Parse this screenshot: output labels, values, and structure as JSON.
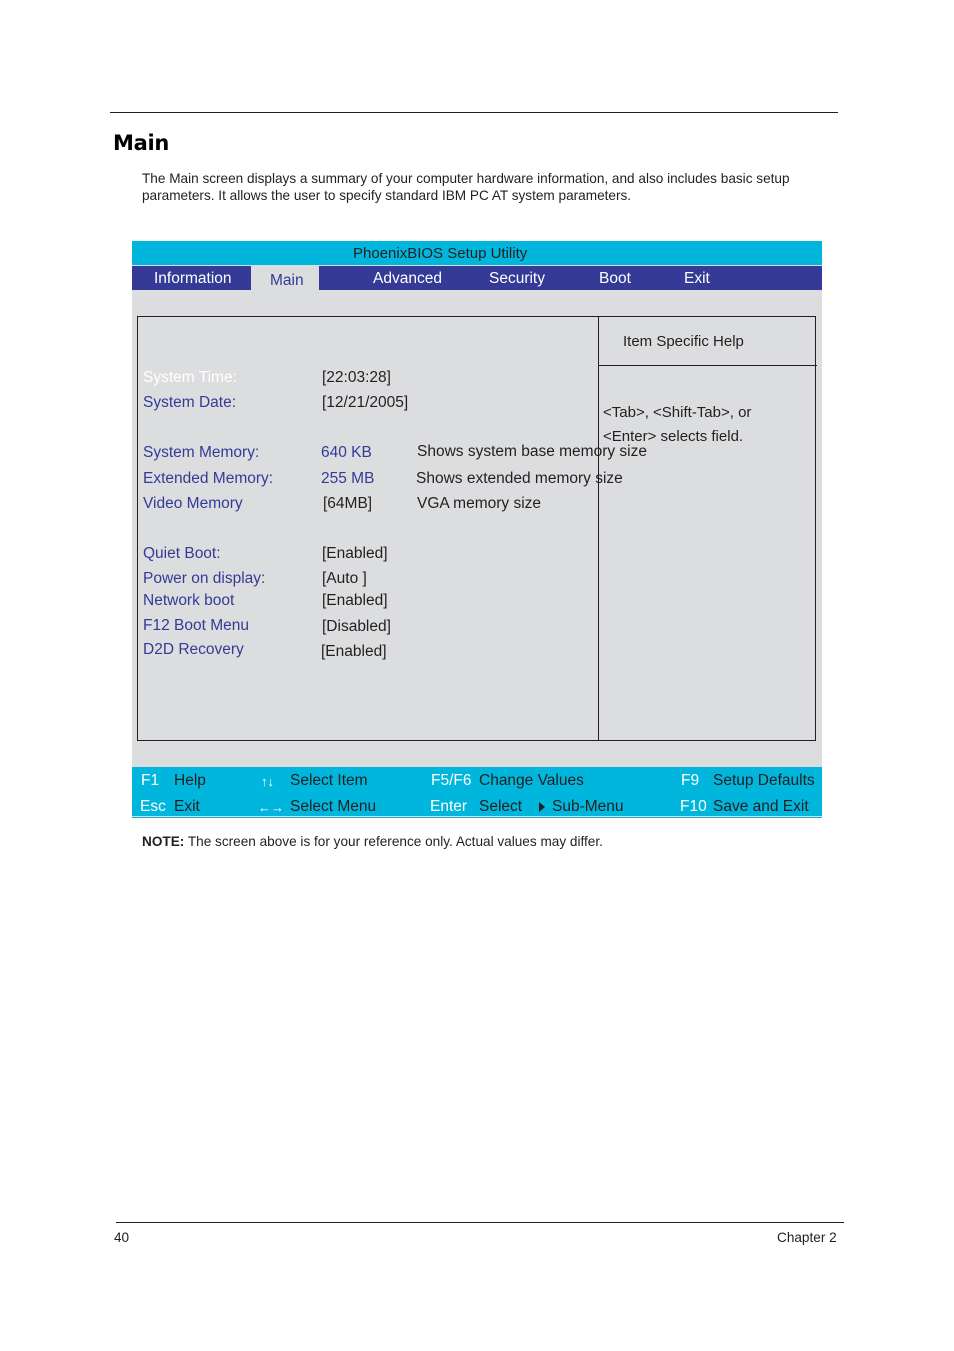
{
  "page": {
    "heading": "Main",
    "intro": "The Main screen displays a summary of your computer hardware information, and also includes basic setup parameters. It allows the user to specify standard IBM PC AT system parameters.",
    "note_label": "NOTE:",
    "note_text": " The screen above is for your reference only. Actual values may differ.",
    "footer_page": "40",
    "footer_chapter": "Chapter 2"
  },
  "bios": {
    "title": "PhoenixBIOS Setup Utility",
    "tabs": [
      {
        "label": "Information",
        "active": false
      },
      {
        "label": "Main",
        "active": true
      },
      {
        "label": "Advanced",
        "active": false
      },
      {
        "label": "Security",
        "active": false
      },
      {
        "label": "Boot",
        "active": false
      },
      {
        "label": "Exit",
        "active": false
      }
    ],
    "items": [
      {
        "label": "System Time:",
        "value": "[22:03:28]",
        "selected": true
      },
      {
        "label": "System Date:",
        "value": "[12/21/2005]"
      },
      {
        "label": "System Memory:",
        "value": "640 KB",
        "description": "Shows system base memory size"
      },
      {
        "label": "Extended Memory:",
        "value": "255 MB",
        "description": "Shows extended memory size"
      },
      {
        "label": "Video Memory",
        "value": "[64MB]",
        "description": "VGA memory size"
      },
      {
        "label": "Quiet Boot:",
        "value": "[Enabled]"
      },
      {
        "label": "Power on display:",
        "value": "[Auto ]"
      },
      {
        "label": "Network boot",
        "value": "[Enabled]"
      },
      {
        "label": "F12 Boot Menu",
        "value": "[Disabled]"
      },
      {
        "label": "D2D Recovery",
        "value": "[Enabled]"
      }
    ],
    "help": {
      "title": "Item Specific Help",
      "line1": "<Tab>, <Shift-Tab>, or",
      "line2": "<Enter> selects field."
    },
    "statusbar": {
      "row1": [
        {
          "key": "F1",
          "desc": "Help"
        },
        {
          "key": "↑↓",
          "desc": "Select Item"
        },
        {
          "key": "F5/F6",
          "desc": "Change Values"
        },
        {
          "key": "F9",
          "desc": "Setup Defaults"
        }
      ],
      "row2": [
        {
          "key": "Esc",
          "desc": "Exit"
        },
        {
          "key": "←→",
          "desc": "Select Menu"
        },
        {
          "key": "Enter",
          "desc": "Select"
        },
        {
          "key": "",
          "desc": "Sub-Menu",
          "icon": "triangle-right-icon"
        },
        {
          "key": "F10",
          "desc": "Save and Exit"
        }
      ]
    },
    "colors": {
      "title_bar": "#00b6dd",
      "menu_bar": "#343a96",
      "body": "#dcdddf",
      "label_text": "#343a96"
    }
  }
}
